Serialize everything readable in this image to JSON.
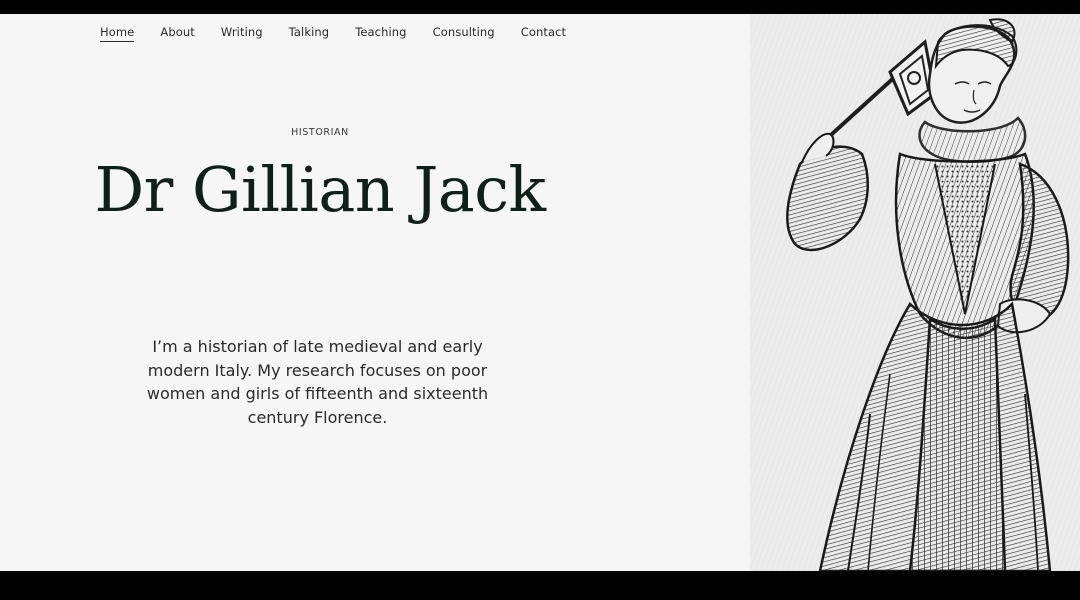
{
  "nav": {
    "items": [
      {
        "label": "Home",
        "active": true
      },
      {
        "label": "About",
        "active": false
      },
      {
        "label": "Writing",
        "active": false
      },
      {
        "label": "Talking",
        "active": false
      },
      {
        "label": "Teaching",
        "active": false
      },
      {
        "label": "Consulting",
        "active": false
      },
      {
        "label": "Contact",
        "active": false
      }
    ]
  },
  "hero": {
    "eyebrow": "HISTORIAN",
    "title": "Dr Gillian Jack",
    "bio": "I’m a historian of late medieval and early modern Italy. My research focuses on poor women and girls of fifteenth and sixteenth century Florence."
  },
  "colors": {
    "page_bg": "#f6f6f6",
    "title": "#0e2118",
    "frame": "#000000"
  }
}
